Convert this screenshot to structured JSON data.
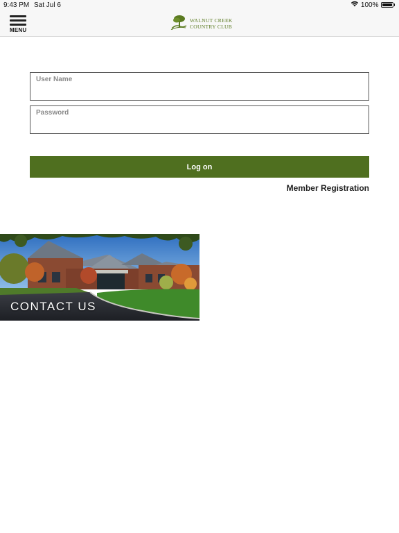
{
  "status_bar": {
    "time": "9:43 PM",
    "date": "Sat Jul 6",
    "battery": "100%",
    "icons": [
      "wifi-icon",
      "battery-icon"
    ]
  },
  "navbar": {
    "menu_label": "MENU",
    "logo_line1": "WALNUT CREEK",
    "logo_line2": "COUNTRY CLUB",
    "icons": [
      "menu-icon",
      "tree-logo-icon"
    ]
  },
  "login": {
    "username_label": "User Name",
    "username_value": "",
    "password_label": "Password",
    "password_value": "",
    "logon_label": "Log on",
    "member_registration_label": "Member Registration"
  },
  "tiles": {
    "contact_label": "CONTACT US"
  },
  "colors": {
    "accent": "#4f6f1f",
    "logo": "#5a7a20",
    "navbar_bg": "#f7f7f7"
  }
}
